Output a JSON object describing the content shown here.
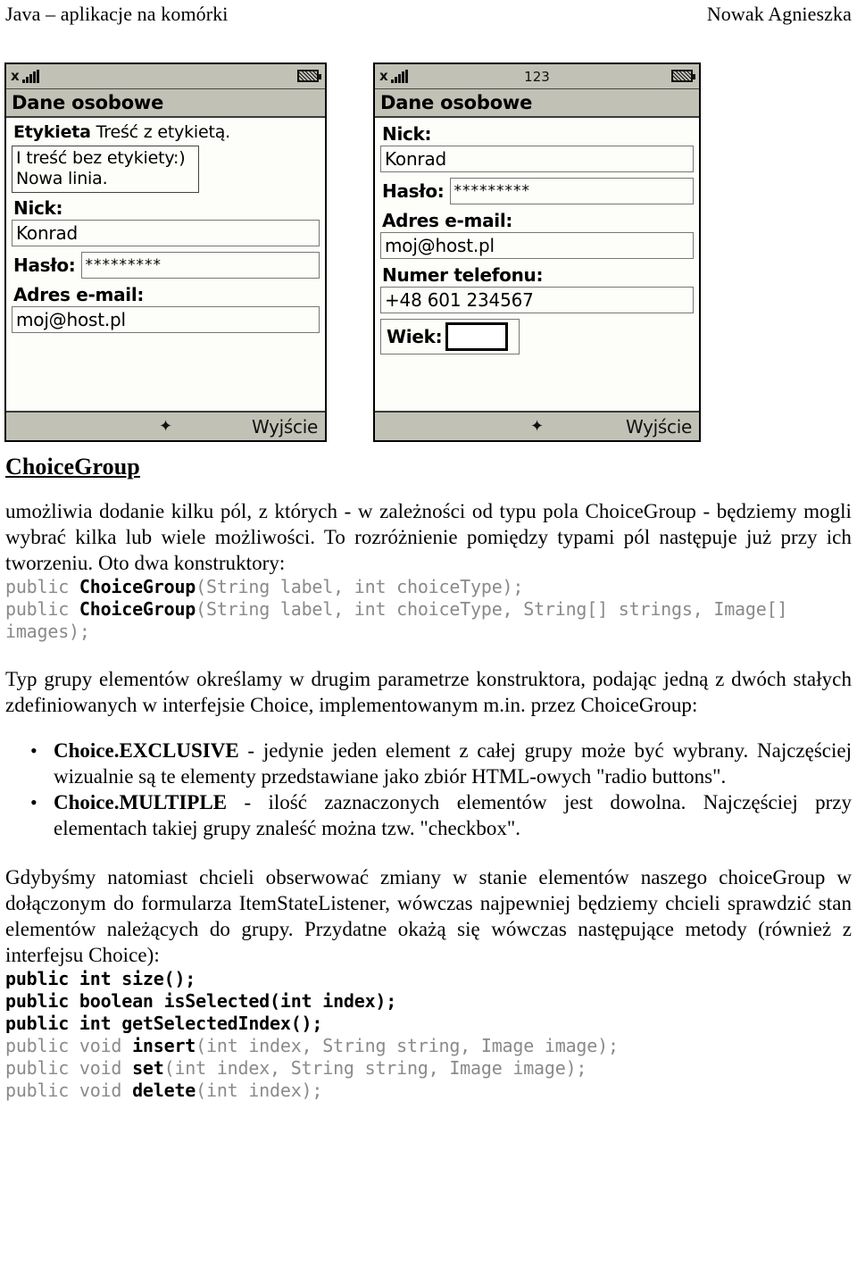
{
  "header": {
    "left": "Java – aplikacje na komórki",
    "right": "Nowak Agnieszka"
  },
  "figures": {
    "phone_left": {
      "statusbar": {
        "antenna_icon": "antenna-icon",
        "signal_icon": "signal-bars-icon",
        "input_mode": "",
        "battery_icon": "battery-icon"
      },
      "title": "Dane osobowe",
      "items": [
        {
          "kind": "string-item",
          "label": "Etykieta",
          "text": "Treść z etykietą."
        },
        {
          "kind": "text-box-multiline",
          "line1": "I treść bez etykiety:)",
          "line2": "Nowa linia."
        },
        {
          "kind": "textfield",
          "label": "Nick:",
          "value": "Konrad"
        },
        {
          "kind": "passwordfield",
          "label": "Hasło:",
          "value": "*********"
        },
        {
          "kind": "textfield",
          "label": "Adres e-mail:",
          "value": "moj@host.pl"
        }
      ],
      "softkeys": {
        "center": "✦",
        "right": "Wyjście"
      }
    },
    "phone_right": {
      "statusbar": {
        "antenna_icon": "antenna-icon",
        "signal_icon": "signal-bars-icon",
        "input_mode": "123",
        "battery_icon": "battery-icon"
      },
      "title": "Dane osobowe",
      "items": [
        {
          "kind": "textfield",
          "label": "Nick:",
          "value": "Konrad"
        },
        {
          "kind": "passwordfield",
          "label": "Hasło:",
          "value": "*********"
        },
        {
          "kind": "textfield",
          "label": "Adres e-mail:",
          "value": "moj@host.pl"
        },
        {
          "kind": "textfield",
          "label": "Numer telefonu:",
          "value": "+48 601 234567"
        },
        {
          "kind": "textfield-focused",
          "label": "Wiek:",
          "value": ""
        }
      ],
      "softkeys": {
        "center": "✦",
        "right": "Wyjście"
      }
    }
  },
  "document": {
    "section_title": "ChoiceGroup",
    "paragraph_1": "umożliwia dodanie kilku pól, z których - w zależności od typu pola ChoiceGroup - będziemy mogli wybrać kilka lub wiele możliwości. To rozróżnienie pomiędzy typami pól następuje już przy ich tworzeniu. Oto dwa konstruktory:",
    "code_constructors": {
      "line1_pre": "public ",
      "line1_name": "ChoiceGroup",
      "line1_post": "(String label, int choiceType);",
      "line2_pre": "public ",
      "line2_name": "ChoiceGroup",
      "line2_post": "(String label, int choiceType, String[] strings, Image[] images);"
    },
    "paragraph_2": "Typ grupy elementów określamy w drugim parametrze konstruktora, podając jedną z dwóch stałych zdefiniowanych w interfejsie Choice, implementowanym m.in. przez ChoiceGroup:",
    "bullets": [
      {
        "term": "Choice.EXCLUSIVE",
        "rest": " - jedynie jeden element z całej grupy może być wybrany. Najczęściej wizualnie są te elementy przedstawiane jako zbiór HTML-owych \"radio buttons\"."
      },
      {
        "term": "Choice.MULTIPLE",
        "rest": " - ilość zaznaczonych elementów jest dowolna. Najczęściej przy elementach takiej grupy znaleść można tzw. \"checkbox\"."
      }
    ],
    "paragraph_3": "Gdybyśmy natomiast chcieli obserwować zmiany w stanie elementów naszego choiceGroup w dołączonym do formularza ItemStateListener, wówczas najpewniej będziemy chcieli sprawdzić stan elementów należących do grupy. Przydatne okażą się wówczas następujące metody (również z interfejsu Choice):",
    "code_methods": {
      "line1": "public int size();",
      "line2": "public boolean isSelected(int index);",
      "line3": "public int getSelectedIndex();",
      "line4_pre": "public void ",
      "line4_name": "insert",
      "line4_post": "(int index, String string, Image image);",
      "line5_pre": "public void ",
      "line5_name": "set",
      "line5_post": "(int index, String string, Image image);",
      "line6_pre": "public void ",
      "line6_name": "delete",
      "line6_post": "(int index);"
    }
  },
  "colors": {
    "chrome": "#c2c1b6",
    "screen": "#fdfdfa",
    "code_gray": "#8a8a8a",
    "text": "#000000"
  }
}
